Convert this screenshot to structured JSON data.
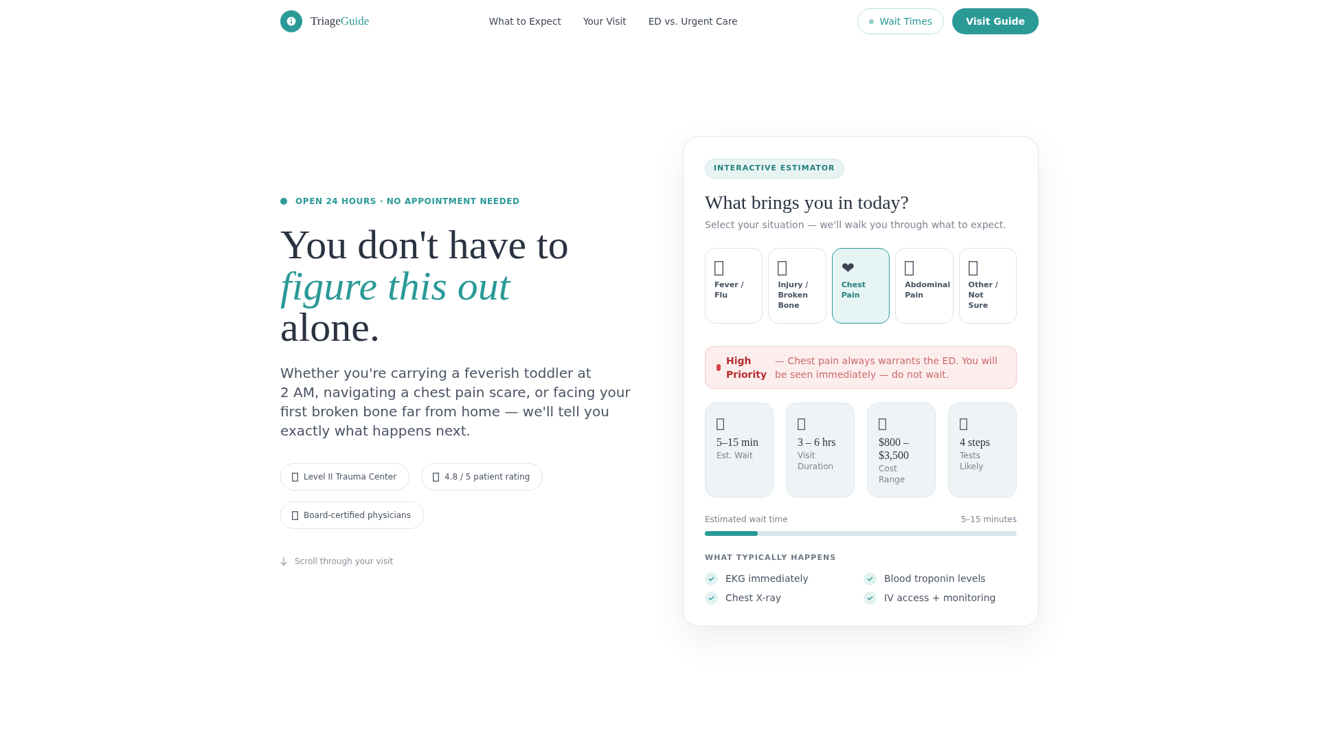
{
  "header": {
    "logo": {
      "name_start": "Triage",
      "name_end": "Guide"
    },
    "nav": [
      {
        "label": "What to Expect"
      },
      {
        "label": "Your Visit"
      },
      {
        "label": "ED vs. Urgent Care"
      }
    ],
    "wait_button": {
      "label": "Wait Times"
    },
    "cta_button": {
      "label": "Visit Guide"
    }
  },
  "hero": {
    "eyebrow": "OPEN 24 HOURS · NO APPOINTMENT NEEDED",
    "headline": "You don't have to *figure this out* alone.",
    "intro": "Whether you're carrying a feverish toddler at 2 AM, navigating a chest pain scare, or facing your first broken bone far from home — we'll tell you exactly what happens next.",
    "trust_badges": [
      {
        "label": "Level II Trauma Center"
      },
      {
        "label": "4.8 / 5 patient rating"
      },
      {
        "label": "Board-certified physicians"
      }
    ],
    "scroll_hint": "Scroll through your visit"
  },
  "estimator": {
    "badge": "INTERACTIVE ESTIMATOR",
    "title": "What brings you in today?",
    "subtitle": "Select your situation — we'll walk you through what to expect.",
    "situations": [
      {
        "label": "Fever /\nFlu",
        "selected": false
      },
      {
        "label": "Injury /\nBroken\nBone",
        "selected": false
      },
      {
        "label": "Chest\nPain",
        "icon": "❤",
        "selected": true
      },
      {
        "label": "Abdominal\nPain",
        "selected": false
      },
      {
        "label": "Other /\nNot\nSure",
        "selected": false
      }
    ],
    "alert": {
      "urgent": true,
      "label": "High Priority",
      "message": "— Chest pain always warrants the ED. You will be seen immediately — do not wait."
    },
    "stats": [
      {
        "value": "5–15 min",
        "label": "Est. Wait"
      },
      {
        "value": "3 – 6 hrs",
        "label": "Visit Duration"
      },
      {
        "value": "$800 – $3,500",
        "label": "Cost Range"
      },
      {
        "value": "4 steps",
        "label": "Tests Likely"
      }
    ],
    "wait_meter": {
      "label": "Estimated wait time",
      "reading": "5–15 minutes",
      "level": 0.17
    },
    "steps_title": "WHAT TYPICALLY HAPPENS",
    "steps": [
      "EKG immediately",
      "Blood troponin levels",
      "Chest X-ray",
      "IV access + monitoring"
    ]
  }
}
